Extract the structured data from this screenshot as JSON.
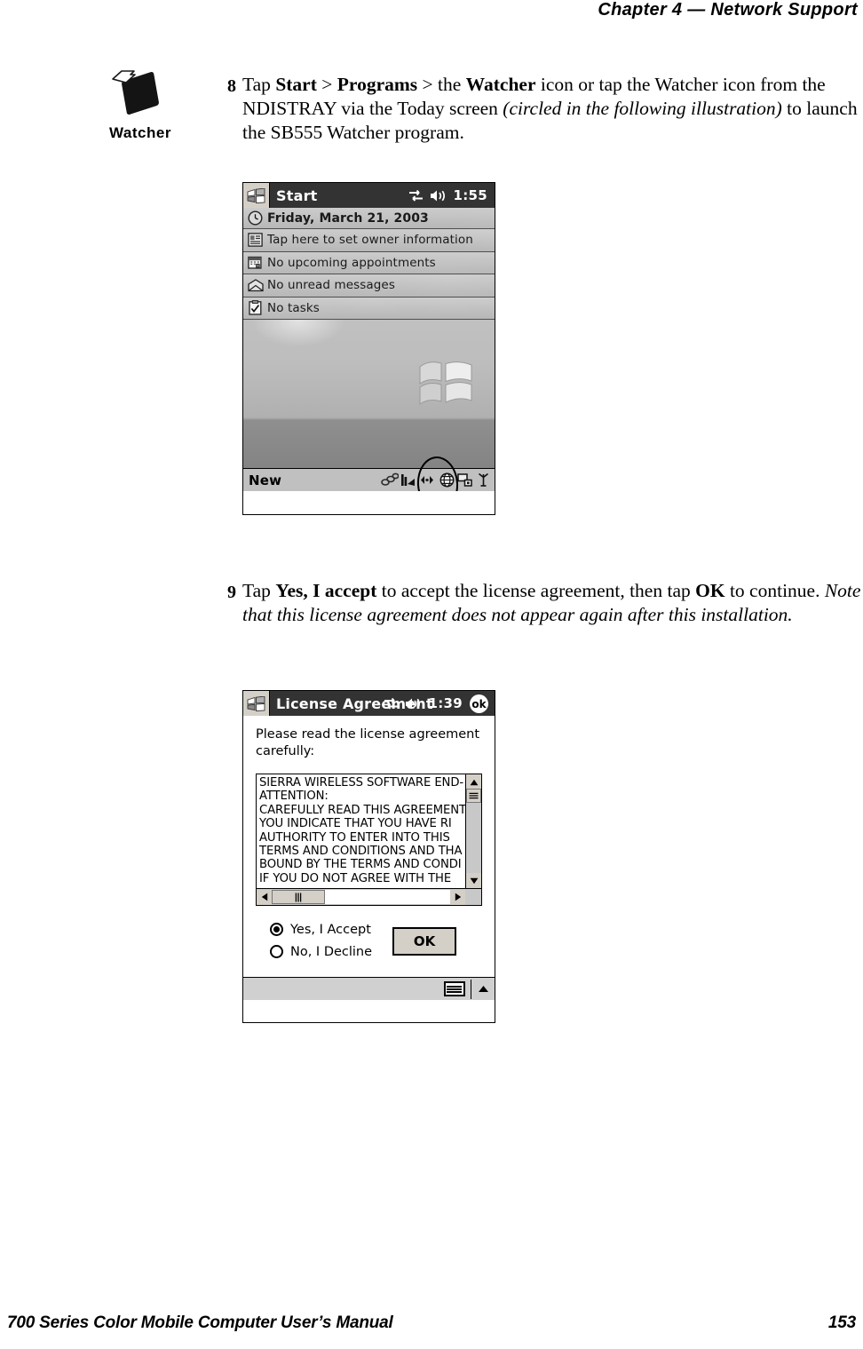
{
  "header": {
    "chapter_label": "Chapter",
    "chapter_number": "4",
    "dash": "—",
    "title": "Network Support"
  },
  "watcher_icon": {
    "label": "Watcher",
    "icon": "watcher-diamond-icon"
  },
  "steps": [
    {
      "number": "8",
      "text_html": "Tap <b>Start</b> &gt; <b>Programs</b> &gt; the <b>Watcher</b> icon or tap the Watcher icon from the NDISTRAY via the Today screen <i>(circled in the following illustration)</i> to launch the SB555 Watcher program."
    },
    {
      "number": "9",
      "text_html": "Tap <b>Yes, I accept</b> to accept the license agreement, then tap <b>OK</b> to continue. <i>Note that this license agreement does not appear again after this installation.</i>"
    }
  ],
  "today_screen": {
    "titlebar": {
      "start_label": "Start",
      "time": "1:55",
      "connectivity_icon": "connectivity-arrows-icon",
      "volume_icon": "speaker-icon",
      "start_icon": "windows-flag-icon"
    },
    "rows": [
      {
        "icon": "clock-icon",
        "label": "Friday, March 21, 2003"
      },
      {
        "icon": "owner-info-icon",
        "label": "Tap here to set owner information"
      },
      {
        "icon": "calendar-icon",
        "label": "No upcoming appointments"
      },
      {
        "icon": "envelope-icon",
        "label": "No unread messages"
      },
      {
        "icon": "tasks-clipboard-icon",
        "label": "No tasks"
      }
    ],
    "taskbar": {
      "new_label": "New",
      "tray_icons": [
        "chain-link-icon",
        "ndistray-icon",
        "speaker-volume-icon",
        "globe-icon",
        "network-connection-icon",
        "antenna-icon"
      ]
    },
    "annotation": "circled-ndistray-icon"
  },
  "license_screen": {
    "titlebar": {
      "title": "License Agreement",
      "time": "1:39",
      "ok_label": "ok",
      "connectivity_icon": "connectivity-arrows-icon",
      "volume_icon": "speaker-icon",
      "start_icon": "windows-flag-icon"
    },
    "intro": "Please read the license agreement\ncarefully:",
    "agreement_lines": [
      "SIERRA WIRELESS SOFTWARE END-",
      "ATTENTION:",
      "CAREFULLY READ THIS AGREEMENT",
      "YOU  INDICATE THAT YOU HAVE RI",
      "AUTHORITY TO ENTER INTO THIS ",
      "TERMS AND CONDITIONS AND THA",
      "BOUND BY THE TERMS AND CONDI",
      "IF YOU DO NOT AGREE WITH THE "
    ],
    "options": [
      {
        "label": "Yes, I Accept",
        "selected": true
      },
      {
        "label": "No, I Decline",
        "selected": false
      }
    ],
    "ok_button_label": "OK",
    "bottom_bar": {
      "keyboard_icon": "keyboard-icon",
      "caret_icon": "up-caret-icon"
    }
  },
  "footer": {
    "manual_title": "700 Series Color Mobile Computer User’s Manual",
    "page_number": "153"
  }
}
